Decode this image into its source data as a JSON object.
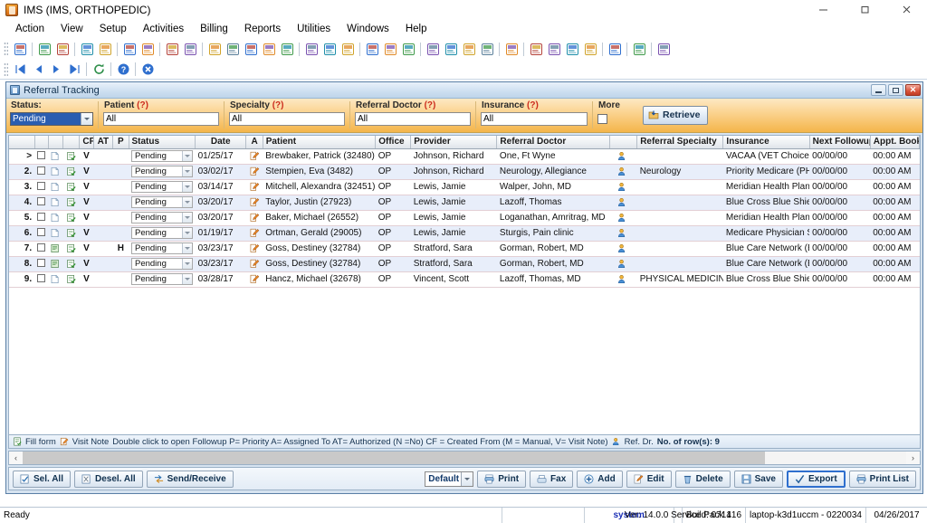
{
  "window": {
    "title": "IMS (IMS, ORTHOPEDIC)",
    "app_icon": "ims-app-icon",
    "minimize": "minimize-icon",
    "maximize": "maximize-icon",
    "close": "close-icon"
  },
  "menu": {
    "items": [
      {
        "label": "Action"
      },
      {
        "label": "View"
      },
      {
        "label": "Setup"
      },
      {
        "label": "Activities"
      },
      {
        "label": "Billing"
      },
      {
        "label": "Reports"
      },
      {
        "label": "Utilities"
      },
      {
        "label": "Windows"
      },
      {
        "label": "Help"
      }
    ]
  },
  "toolbar_primary": {
    "icons": [
      "patient-icon",
      "sep",
      "patient-add-icon",
      "patient-edit-icon",
      "sep",
      "folder-open-icon",
      "note-edit-icon",
      "sep",
      "prescription-icon",
      "lab-flask-icon",
      "sep",
      "encounter-icon",
      "document-icon",
      "sep",
      "charges-icon",
      "payment-icon",
      "claims-icon",
      "ledger-icon",
      "collections-icon",
      "sep",
      "schedule-icon",
      "appointment-icon",
      "authorization-icon",
      "sep",
      "back-arrow-icon",
      "refresh-globe-icon",
      "globe-icon",
      "sep",
      "referral-icon",
      "referral-out-icon",
      "reports-chart-icon",
      "export-icon",
      "sep",
      "analytics-icon",
      "sep",
      "lock-open-icon",
      "transfer-icon",
      "word-icon",
      "wizard-icon",
      "sep",
      "help-icon",
      "sep",
      "security-lock-icon",
      "sep",
      "exit-icon"
    ]
  },
  "toolbar_secondary": {
    "icons": [
      "first-record-icon",
      "previous-record-icon",
      "next-record-icon",
      "last-record-icon",
      "sep",
      "refresh-icon",
      "sep",
      "help-circle-icon",
      "sep",
      "close-circle-icon"
    ]
  },
  "child_window": {
    "title": "Referral Tracking",
    "icon": "referral-tracking-icon",
    "minimize_label": "minimize-icon",
    "restore_label": "restore-icon",
    "close_label": "close-icon"
  },
  "filters": {
    "status": {
      "label": "Status:",
      "value": "Pending"
    },
    "patient": {
      "label": "Patient",
      "hint": "(?)",
      "value": "All"
    },
    "specialty": {
      "label": "Specialty",
      "hint": "(?)",
      "value": "All"
    },
    "referral_doctor": {
      "label": "Referral Doctor",
      "hint": "(?)",
      "value": "All"
    },
    "insurance": {
      "label": "Insurance",
      "hint": "(?)",
      "value": "All"
    },
    "more": {
      "label": "More",
      "checked": false
    },
    "retrieve": {
      "label": "Retrieve",
      "accesskey": "R",
      "icon": "retrieve-icon"
    }
  },
  "grid": {
    "columns": [
      {
        "key": "rownum",
        "label": ""
      },
      {
        "key": "check",
        "label": ""
      },
      {
        "key": "fillform",
        "label": ""
      },
      {
        "key": "visitnote",
        "label": ""
      },
      {
        "key": "cf",
        "label": "CF"
      },
      {
        "key": "at",
        "label": "AT"
      },
      {
        "key": "p",
        "label": "P"
      },
      {
        "key": "status",
        "label": "Status"
      },
      {
        "key": "date",
        "label": "Date"
      },
      {
        "key": "a",
        "label": "A"
      },
      {
        "key": "patient",
        "label": "Patient"
      },
      {
        "key": "office",
        "label": "Office"
      },
      {
        "key": "provider",
        "label": "Provider"
      },
      {
        "key": "referral_doctor",
        "label": "Referral Doctor"
      },
      {
        "key": "referral_specialty",
        "label": "Referral Specialty"
      },
      {
        "key": "insurance",
        "label": "Insurance"
      },
      {
        "key": "next_followup",
        "label": "Next Followup"
      },
      {
        "key": "appt_booked",
        "label": "Appt. Booked"
      }
    ],
    "rows": [
      {
        "rownum": ">",
        "selected": true,
        "cf": "V",
        "at": "",
        "p": "",
        "status": "Pending",
        "date": "01/25/17",
        "a": "",
        "patient": "Brewbaker, Patrick (32480)",
        "office": "OP",
        "provider": "Johnson, Richard",
        "referral_doctor": "One, Ft Wyne",
        "referral_specialty": "",
        "insurance": "VACAA  (VET Choice)  (VACAA)",
        "next_followup": "00/00/00",
        "appt_booked": "00:00 AM"
      },
      {
        "rownum": "2.",
        "cf": "V",
        "at": "",
        "p": "",
        "status": "Pending",
        "date": "03/02/17",
        "a": "",
        "patient": "Stempien, Eva (3482)",
        "office": "OP",
        "provider": "Johnson, Richard",
        "referral_doctor": "Neurology, Allegiance",
        "referral_specialty": "Neurology",
        "insurance": "Priority Medicare  (PHMCR)    PI",
        "next_followup": "00/00/00",
        "appt_booked": "00:00 AM"
      },
      {
        "rownum": "3.",
        "cf": "V",
        "at": "",
        "p": "",
        "status": "Pending",
        "date": "03/14/17",
        "a": "",
        "patient": "Mitchell, Alexandra (32451)",
        "office": "OP",
        "provider": "Lewis, Jamie",
        "referral_doctor": "Walper, John, MD",
        "referral_specialty": "",
        "insurance": "Meridian Health Plan   (MHP)     M",
        "next_followup": "00/00/00",
        "appt_booked": "00:00 AM"
      },
      {
        "rownum": "4.",
        "cf": "V",
        "at": "",
        "p": "",
        "status": "Pending",
        "date": "03/20/17",
        "a": "",
        "patient": "Taylor, Justin (27923)",
        "office": "OP",
        "provider": "Lewis, Jamie",
        "referral_doctor": "Lazoff, Thomas",
        "referral_specialty": "",
        "insurance": "Blue Cross Blue Shield   (bcbs)",
        "next_followup": "00/00/00",
        "appt_booked": "00:00 AM"
      },
      {
        "rownum": "5.",
        "cf": "V",
        "at": "",
        "p": "",
        "status": "Pending",
        "date": "03/20/17",
        "a": "",
        "patient": "Baker, Michael (26552)",
        "office": "OP",
        "provider": "Lewis, Jamie",
        "referral_doctor": "Loganathan, Amritrag, MD",
        "referral_specialty": "",
        "insurance": "Meridian Health Plan   (MHP)     M",
        "next_followup": "00/00/00",
        "appt_booked": "00:00 AM"
      },
      {
        "rownum": "6.",
        "cf": "V",
        "at": "",
        "p": "",
        "status": "Pending",
        "date": "01/19/17",
        "a": "",
        "patient": "Ortman, Gerald (29005)",
        "office": "OP",
        "provider": "Lewis, Jamie",
        "referral_doctor": "Sturgis, Pain clinic",
        "referral_specialty": "",
        "insurance": "Medicare Physician Services   (M",
        "next_followup": "00/00/00",
        "appt_booked": "00:00 AM"
      },
      {
        "rownum": "7.",
        "cf": "V",
        "at": "",
        "p": "H",
        "altdoc": true,
        "status": "Pending",
        "date": "03/23/17",
        "a": "",
        "patient": "Goss, Destiney (32784)",
        "office": "OP",
        "provider": "Stratford, Sara",
        "referral_doctor": "Gorman, Robert, MD",
        "referral_specialty": "",
        "insurance": "Blue Care Network   (BCN)      BCI",
        "next_followup": "00/00/00",
        "appt_booked": "00:00 AM"
      },
      {
        "rownum": "8.",
        "cf": "V",
        "at": "",
        "p": "",
        "altdoc": true,
        "status": "Pending",
        "date": "03/23/17",
        "a": "",
        "patient": "Goss, Destiney (32784)",
        "office": "OP",
        "provider": "Stratford, Sara",
        "referral_doctor": "Gorman, Robert, MD",
        "referral_specialty": "",
        "insurance": "Blue Care Network   (BCN)      BCI",
        "next_followup": "00/00/00",
        "appt_booked": "00:00 AM"
      },
      {
        "rownum": "9.",
        "cf": "V",
        "at": "",
        "p": "",
        "status": "Pending",
        "date": "03/28/17",
        "a": "",
        "patient": "Hancz, Michael (32678)",
        "office": "OP",
        "provider": "Vincent, Scott",
        "referral_doctor": "Lazoff, Thomas, MD",
        "referral_specialty": "PHYSICAL MEDICINE &",
        "insurance": "Blue Cross Blue Shield   (bcbs)",
        "next_followup": "00/00/00",
        "appt_booked": "00:00 AM"
      }
    ]
  },
  "legend": {
    "fill_form": "Fill form",
    "visit_note": "Visit Note",
    "text": "Double click to open Followup  P= Priority  A= Assigned To  AT= Authorized (N =No)  CF = Created From (M = Manual, V= Visit Note)",
    "ref_dr": "Ref. Dr.",
    "row_count": "No. of row(s): 9"
  },
  "buttons": {
    "sel_all": {
      "label": "Sel. All",
      "icon": "select-all-icon"
    },
    "desel_all": {
      "label": "Desel. All",
      "icon": "deselect-all-icon"
    },
    "send_receive": {
      "label": "Send/Receive",
      "icon": "send-receive-icon"
    },
    "template": {
      "value": "Default"
    },
    "print": {
      "label": "Print",
      "icon": "print-icon"
    },
    "fax": {
      "label": "Fax",
      "icon": "fax-icon"
    },
    "add": {
      "label": "Add",
      "icon": "add-icon"
    },
    "edit": {
      "label": "Edit",
      "icon": "edit-icon"
    },
    "delete": {
      "label": "Delete",
      "icon": "delete-icon"
    },
    "save": {
      "label": "Save",
      "icon": "save-icon"
    },
    "export": {
      "label": "Export",
      "icon": "export-check-icon"
    },
    "print_list": {
      "label": "Print List",
      "icon": "print-list-icon"
    }
  },
  "statusbar": {
    "ready": "Ready",
    "blank": "",
    "user": "system",
    "version": "Ver: 14.0.0 Service Pack 1",
    "build": "Build: 071416",
    "machine": "laptop-k3d1uccm - 0220034",
    "date": "04/26/2017"
  },
  "colors": {
    "filter_amber": "#f7c268",
    "accent_blue": "#2f6fce",
    "selection_blue": "#2a5db0",
    "alt_row": "#e8eefa",
    "close_red": "#d9543a"
  }
}
